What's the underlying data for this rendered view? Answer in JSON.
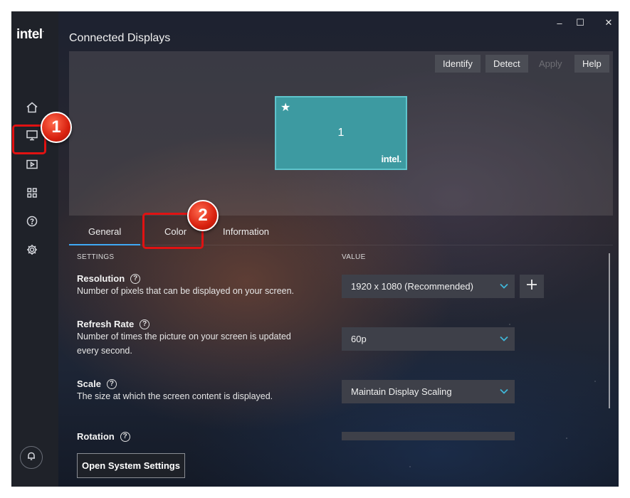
{
  "app": {
    "logo": "intel",
    "logo_mark": "."
  },
  "window_controls": {
    "minimize": "–",
    "maximize": "☐",
    "close": "✕"
  },
  "page": {
    "title": "Connected Displays"
  },
  "sidebar": {
    "items": [
      {
        "icon": "home-icon"
      },
      {
        "icon": "display-icon",
        "active": true
      },
      {
        "icon": "video-icon"
      },
      {
        "icon": "apps-grid-icon"
      },
      {
        "icon": "help-circle-icon"
      },
      {
        "icon": "gear-icon"
      }
    ],
    "bottom_icon": "bell-icon"
  },
  "toolbar": {
    "identify": "Identify",
    "detect": "Detect",
    "apply": "Apply",
    "help": "Help"
  },
  "display_tile": {
    "star": "★",
    "number": "1",
    "logo": "intel."
  },
  "tabs": [
    {
      "label": "General",
      "active": true
    },
    {
      "label": "Color"
    },
    {
      "label": "Information"
    }
  ],
  "columns": {
    "settings": "SETTINGS",
    "value": "VALUE"
  },
  "settings": [
    {
      "name": "Resolution",
      "description": "Number of pixels that can be displayed on your screen.",
      "value": "1920 x 1080 (Recommended)"
    },
    {
      "name": "Refresh Rate",
      "description_line1": "Number of times the picture on your screen is updated",
      "description_line2": "every second.",
      "value": "60p"
    },
    {
      "name": "Scale",
      "description": "The size at which the screen content is displayed.",
      "value": "Maintain Display Scaling"
    },
    {
      "name": "Rotation",
      "value": ""
    }
  ],
  "help_glyph": "?",
  "footer": {
    "open_system_settings": "Open System Settings"
  },
  "annotations": {
    "step1": "1",
    "step2": "2"
  },
  "colors": {
    "accent": "#3fa9f5",
    "annotation": "#e01212",
    "tile": "#3d9aa1"
  }
}
